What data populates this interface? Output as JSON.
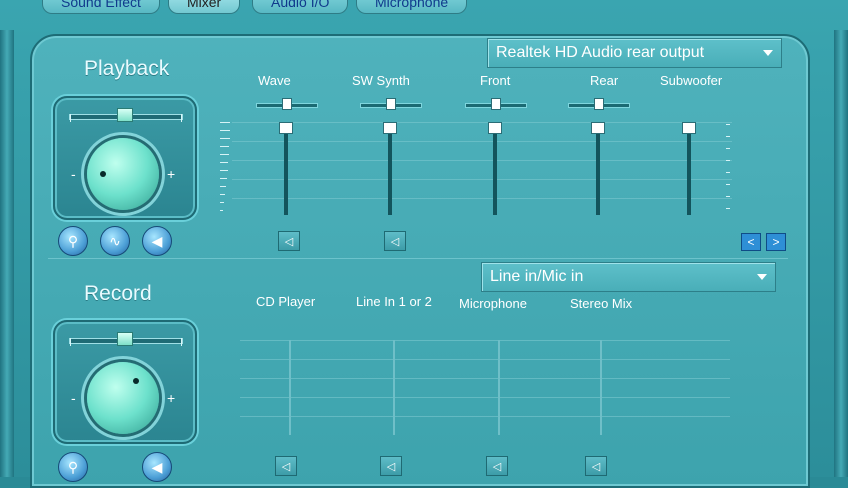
{
  "tabs": [
    {
      "label": "Sound Effect",
      "active": false
    },
    {
      "label": "Mixer",
      "active": true
    },
    {
      "label": "Audio I/O",
      "active": false
    },
    {
      "label": "Microphone",
      "active": false
    }
  ],
  "playback": {
    "title": "Playback",
    "output_device": "Realtek HD Audio rear output",
    "minus": "-",
    "plus": "+",
    "channels": [
      {
        "label": "Wave"
      },
      {
        "label": "SW Synth"
      },
      {
        "label": "Front"
      },
      {
        "label": "Rear"
      },
      {
        "label": "Subwoofer"
      }
    ],
    "mute_icon": "speaker-icon",
    "nav_prev": "<",
    "nav_next": ">"
  },
  "record": {
    "title": "Record",
    "input_device": "Line in/Mic in",
    "minus": "-",
    "plus": "+",
    "channels": [
      {
        "label": "CD Player"
      },
      {
        "label": "Line In 1 or 2"
      },
      {
        "label": "Microphone"
      },
      {
        "label": "Stereo Mix"
      }
    ]
  },
  "colors": {
    "accent": "#3da3ad",
    "tab_text": "#103a8c",
    "knob": "#6de1cc"
  }
}
